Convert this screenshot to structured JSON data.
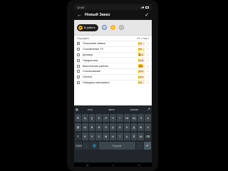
{
  "status_bar": {
    "time": "12:00"
  },
  "app_bar": {
    "title": "Новый Заказ",
    "back_icon": "arrow-left-icon",
    "confirm_icon": "check-icon"
  },
  "status_row": {
    "chip_label": "В работе",
    "chip_icon": "rocket-icon"
  },
  "list": {
    "header_left": "Подзадачи",
    "header_right": "2% 1 нед 6",
    "items": [
      {
        "label": "Получение заявок",
        "checked": true,
        "percent": "2%",
        "progress": 0.02
      },
      {
        "label": "Составление ТЗ",
        "checked": false,
        "percent": "5%",
        "progress": 0.05
      },
      {
        "label": "Договор",
        "checked": false,
        "percent": "32%",
        "progress": 0.32
      },
      {
        "label": "Предоплата",
        "checked": false,
        "percent": "12%",
        "progress": 0.12
      },
      {
        "label": "Выполнение работы",
        "checked": false,
        "percent": "68%",
        "progress": 0.68
      },
      {
        "label": "Согласование",
        "checked": false,
        "percent": "12%",
        "progress": 0.12
      },
      {
        "label": "Оплата",
        "checked": false,
        "percent": "12%",
        "progress": 0.12
      },
      {
        "label": "Передача материала",
        "checked": false,
        "percent": "2%",
        "progress": 0.02
      }
    ]
  },
  "keyboard": {
    "suggestions": [
      "есть",
      "часть",
      "россии"
    ],
    "row1": [
      "й",
      "ц",
      "у",
      "к",
      "е",
      "н",
      "г",
      "ш",
      "щ",
      "з",
      "х"
    ],
    "row2": [
      "ф",
      "ы",
      "в",
      "а",
      "п",
      "р",
      "о",
      "л",
      "д",
      "ж",
      "э"
    ],
    "row3": [
      "я",
      "ч",
      "с",
      "м",
      "и",
      "т",
      "ь",
      "б",
      "ю"
    ],
    "symbols_label": "?123",
    "space_label": "Русский"
  }
}
